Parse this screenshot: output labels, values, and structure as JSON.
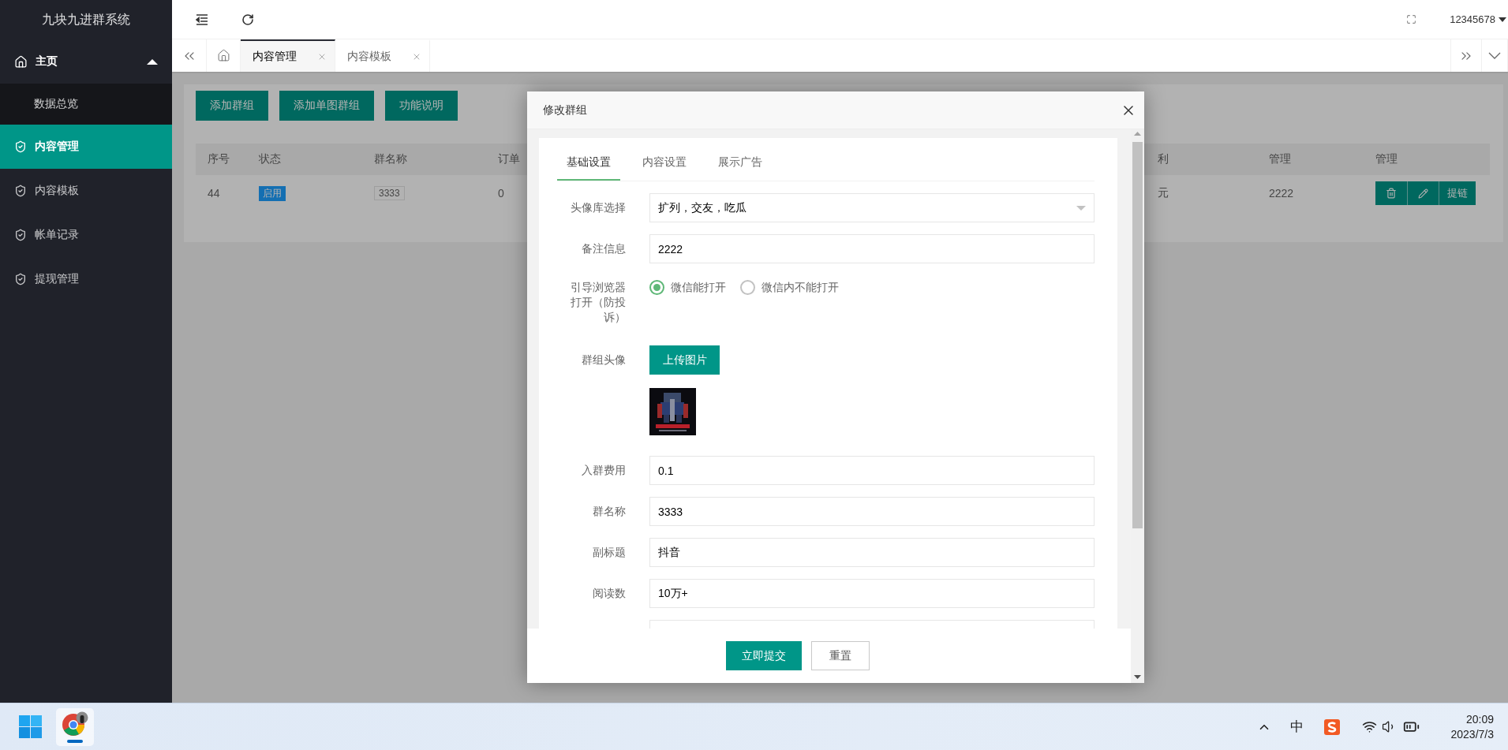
{
  "sidebar": {
    "title": "九块九进群系统",
    "items": [
      {
        "kind": "group",
        "label": "主页",
        "selected": false,
        "expanded": true,
        "children": [
          {
            "label": "数据总览",
            "selected": false
          }
        ]
      },
      {
        "kind": "link",
        "label": "内容管理",
        "selected": true
      },
      {
        "kind": "link",
        "label": "内容模板",
        "selected": false
      },
      {
        "kind": "link",
        "label": "帐单记录",
        "selected": false
      },
      {
        "kind": "link",
        "label": "提现管理",
        "selected": false
      }
    ]
  },
  "header": {
    "user": "12345678"
  },
  "tabs": [
    {
      "label": "内容管理",
      "selected": true
    },
    {
      "label": "内容模板",
      "selected": false
    }
  ],
  "toolbar": {
    "buttons": [
      "添加群组",
      "添加单图群组",
      "功能说明"
    ]
  },
  "table": {
    "columns": [
      "序号",
      "状态",
      "群名称",
      "订单",
      "利",
      "管理",
      "管理"
    ],
    "rows": [
      {
        "cells": [
          {
            "kind": "text",
            "text": "44"
          },
          {
            "kind": "badge",
            "text": "启用"
          },
          {
            "kind": "tag",
            "text": "3333"
          },
          {
            "kind": "text",
            "text": "0"
          },
          {
            "kind": "text",
            "text": "元"
          },
          {
            "kind": "text",
            "text": "2222"
          },
          {
            "kind": "actions",
            "text": "提链"
          }
        ]
      }
    ]
  },
  "modal": {
    "title": "修改群组",
    "tabs": [
      {
        "label": "基础设置",
        "selected": true
      },
      {
        "label": "内容设置",
        "selected": false
      },
      {
        "label": "展示广告",
        "selected": false
      }
    ],
    "fields": [
      {
        "kind": "select",
        "label": "头像库选择",
        "value": "扩列，交友，吃瓜"
      },
      {
        "kind": "input",
        "label": "备注信息",
        "value": "2222"
      },
      {
        "kind": "radio",
        "label": "引导浏览器打开（防投诉）",
        "options": [
          {
            "label": "微信能打开",
            "selected": true
          },
          {
            "label": "微信内不能打开",
            "selected": false
          }
        ]
      },
      {
        "kind": "upload",
        "label": "群组头像",
        "button": "上传图片"
      },
      {
        "kind": "input",
        "label": "入群费用",
        "value": "0.1"
      },
      {
        "kind": "input",
        "label": "群名称",
        "value": "3333"
      },
      {
        "kind": "input",
        "label": "副标题",
        "value": "抖音"
      },
      {
        "kind": "input",
        "label": "阅读数",
        "value": "10万+"
      },
      {
        "kind": "input"
      }
    ],
    "buttons": [
      {
        "kind": "primary",
        "label": "立即提交"
      },
      {
        "kind": "plain",
        "label": "重置"
      }
    ]
  },
  "taskbar": {
    "ime": "中",
    "time": "20:09",
    "date": "2023/7/3"
  }
}
